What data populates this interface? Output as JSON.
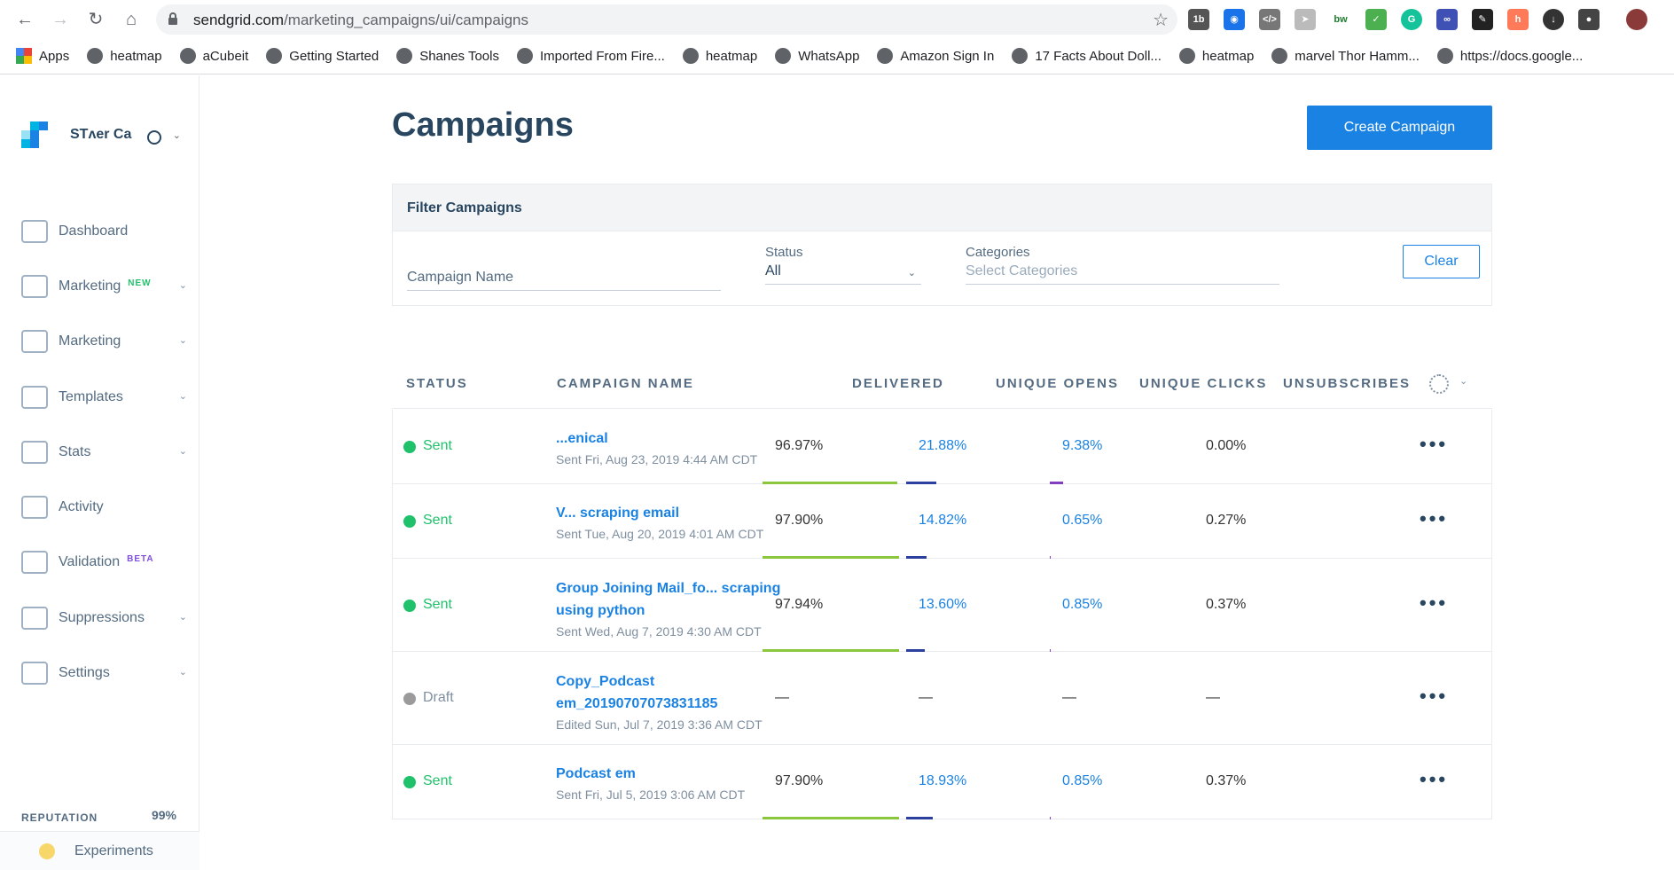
{
  "browser": {
    "url_host": "sendgrid.com",
    "url_path": "/marketing_campaigns/ui/campaigns",
    "bookmarks": [
      "Apps",
      "heatmap",
      "aCubeit",
      "Getting Started",
      "Shanes Tools",
      "Imported From Fire...",
      "heatmap",
      "WhatsApp",
      "Amazon Sign In",
      "17 Facts About Doll...",
      "heatmap",
      "marvel Thor Hamm...",
      "https://docs.google..."
    ]
  },
  "sidebar": {
    "account_name": "STʌer Ca",
    "items": [
      {
        "label": "Dashboard",
        "badge": "",
        "caret": false
      },
      {
        "label": "Marketing",
        "badge": "NEW",
        "caret": true
      },
      {
        "label": "Marketing",
        "badge": "",
        "caret": true
      },
      {
        "label": "Templates",
        "badge": "",
        "caret": true
      },
      {
        "label": "Stats",
        "badge": "",
        "caret": true
      },
      {
        "label": "Activity",
        "badge": "",
        "caret": false
      },
      {
        "label": "Validation",
        "badge": "BETA",
        "caret": false
      },
      {
        "label": "Suppressions",
        "badge": "",
        "caret": true
      },
      {
        "label": "Settings",
        "badge": "",
        "caret": true
      }
    ],
    "reputation_label": "REPUTATION",
    "reputation_value": "99%",
    "experiments_label": "Experiments"
  },
  "page": {
    "title": "Campaigns",
    "create_button": "Create Campaign"
  },
  "filter": {
    "heading": "Filter Campaigns",
    "campaign_name_placeholder": "Campaign Name",
    "status_label": "Status",
    "status_value": "All",
    "categories_label": "Categories",
    "categories_placeholder": "Select Categories",
    "clear_button": "Clear"
  },
  "table": {
    "headers": [
      "STATUS",
      "CAMPAIGN NAME",
      "DELIVERED",
      "UNIQUE OPENS",
      "UNIQUE CLICKS",
      "UNSUBSCRIBES"
    ],
    "rows": [
      {
        "status": "Sent",
        "name": "...enical",
        "subtitle": "Sent Fri, Aug 23, 2019 4:44 AM CDT",
        "delivered": "96.97%",
        "opens": "21.88%",
        "clicks": "9.38%",
        "unsubs": "0.00%",
        "delivered_frac": 0.9697,
        "opens_frac": 0.2188,
        "clicks_frac": 0.0938
      },
      {
        "status": "Sent",
        "name": "V... scraping email",
        "subtitle": "Sent Tue, Aug 20, 2019 4:01 AM CDT",
        "delivered": "97.90%",
        "opens": "14.82%",
        "clicks": "0.65%",
        "unsubs": "0.27%",
        "delivered_frac": 0.979,
        "opens_frac": 0.1482,
        "clicks_frac": 0.0065
      },
      {
        "status": "Sent",
        "name": "Group Joining Mail_fo... scraping using python",
        "subtitle": "Sent Wed, Aug 7, 2019 4:30 AM CDT",
        "delivered": "97.94%",
        "opens": "13.60%",
        "clicks": "0.85%",
        "unsubs": "0.37%",
        "delivered_frac": 0.9794,
        "opens_frac": 0.136,
        "clicks_frac": 0.0085
      },
      {
        "status": "Draft",
        "name": "Copy_Podcast em_20190707073831185",
        "subtitle": "Edited Sun, Jul 7, 2019 3:36 AM CDT",
        "delivered": "—",
        "opens": "—",
        "clicks": "—",
        "unsubs": "—",
        "delivered_frac": 0,
        "opens_frac": 0,
        "clicks_frac": 0
      },
      {
        "status": "Sent",
        "name": "Podcast em",
        "subtitle": "Sent Fri, Jul 5, 2019 3:06 AM CDT",
        "delivered": "97.90%",
        "opens": "18.93%",
        "clicks": "0.85%",
        "unsubs": "0.37%",
        "delivered_frac": 0.979,
        "opens_frac": 0.1893,
        "clicks_frac": 0.0085
      }
    ]
  },
  "colors": {
    "sent": "#1fc16b",
    "draft": "#9b9b9b",
    "delivered_bar": "#8cc63f",
    "opens_bar": "#2c3e9e",
    "clicks_bar": "#7f3fbf",
    "link": "#1a82e2"
  }
}
